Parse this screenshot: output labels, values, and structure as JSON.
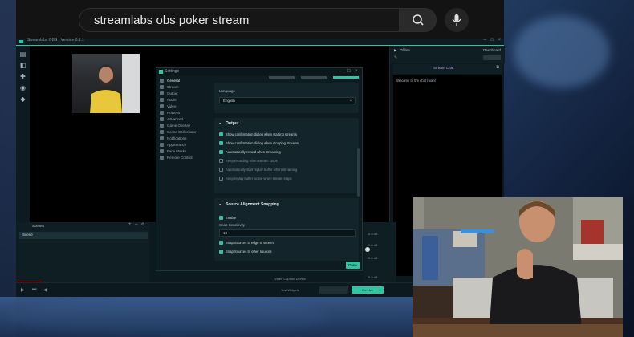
{
  "browser": {
    "search_query": "streamlabs obs poker stream"
  },
  "obs": {
    "window_title": "Streamlabs OBS · Version 0.1.1",
    "chat_header_status": "Offline",
    "chat_header_right": "Dashboard",
    "chat_tab_label": "Stream Chat",
    "chat_welcome": "Welcome to the chat room!",
    "scenes_title": "Scenes",
    "scene_item": "Scene",
    "mixer_values": [
      "0.0 dB",
      "0.0 dB",
      "0.0 dB",
      "0.0 dB"
    ],
    "status_bar": {
      "test_widgets": "Test Widgets",
      "go_live": "Go Live",
      "video_capture": "Video Capture Device"
    }
  },
  "settings": {
    "title": "Settings",
    "nav": [
      {
        "label": "General",
        "active": true
      },
      {
        "label": "Stream",
        "active": false
      },
      {
        "label": "Output",
        "active": false
      },
      {
        "label": "Audio",
        "active": false
      },
      {
        "label": "Video",
        "active": false
      },
      {
        "label": "Hotkeys",
        "active": false
      },
      {
        "label": "Advanced",
        "active": false
      },
      {
        "label": "Game Overlay",
        "active": false
      },
      {
        "label": "Scene Collections",
        "active": false
      },
      {
        "label": "Notifications",
        "active": false
      },
      {
        "label": "Appearance",
        "active": false
      },
      {
        "label": "Face Masks",
        "active": false
      },
      {
        "label": "Remote Control",
        "active": false
      }
    ],
    "language_label": "Language",
    "language_value": "English",
    "output_heading": "Output",
    "output_options": [
      {
        "label": "Show confirmation dialog when starting streams",
        "checked": true
      },
      {
        "label": "Show confirmation dialog when stopping streams",
        "checked": true
      },
      {
        "label": "Automatically record when streaming",
        "checked": true
      },
      {
        "label": "Keep recording when stream stops",
        "checked": false
      },
      {
        "label": "Automatically start replay buffer when streaming",
        "checked": false
      },
      {
        "label": "Keep replay buffer active when stream stops",
        "checked": false
      }
    ],
    "snapping_heading": "Source Alignment Snapping",
    "enable_label": "Enable",
    "enable_checked": true,
    "sensitivity_label": "Snap Sensitivity",
    "sensitivity_value": "10",
    "snap_screen_label": "Snap Sources to edge of screen",
    "snap_other_label": "Snap Sources to other sources",
    "done_label": "Done"
  },
  "colors": {
    "accent": "#31c3a2",
    "obs_bg": "#09161b",
    "panel": "#13252b"
  }
}
